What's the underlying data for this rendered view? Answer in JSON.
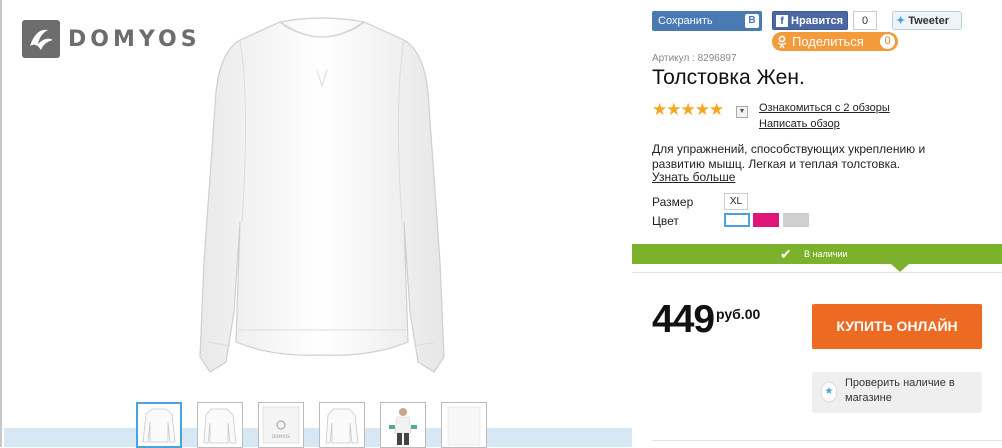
{
  "brand": {
    "logo_text": "DOMYOS"
  },
  "gallery": {
    "main_image": "white-sweatshirt-photo",
    "thumbnails": [
      "sweatshirt-front",
      "sweatshirt-side",
      "sweatshirt-detail",
      "sweatshirt-back",
      "model-wearing",
      "sweatshirt-plain"
    ]
  },
  "social": {
    "save_label": "Сохранить",
    "vk_letter": "В",
    "fb_label": "Нравится",
    "fb_letter": "f",
    "fb_count": "0",
    "twitter_label": "Tweeter",
    "ok_label": "Поделиться",
    "ok_count": "0"
  },
  "product": {
    "sku": "Артикул : 8296897",
    "title": "Толстовка Жен.",
    "rating_stars": "★★★★★",
    "reviews_link": "Ознакомиться с 2 обзоры",
    "write_review_link": "Написать обзор",
    "description": "Для упражнений, способствующих укреплению и развитию мышц. Легкая и теплая толстовка.",
    "more_link": "Узнать больше",
    "size_label": "Размер",
    "size_value": "XL",
    "color_label": "Цвет",
    "colors": [
      "#ffffff",
      "#e0157a",
      "#cfcfcf"
    ],
    "availability": "В наличии",
    "price": "449",
    "price_currency": "руб.00",
    "buy_label": "КУПИТЬ ОНЛАЙН",
    "store_check_label": "Проверить наличие в магазине"
  },
  "colors": {
    "accent_orange": "#ed6a22",
    "availability_green": "#7cb22b",
    "star_yellow": "#f5a623"
  }
}
